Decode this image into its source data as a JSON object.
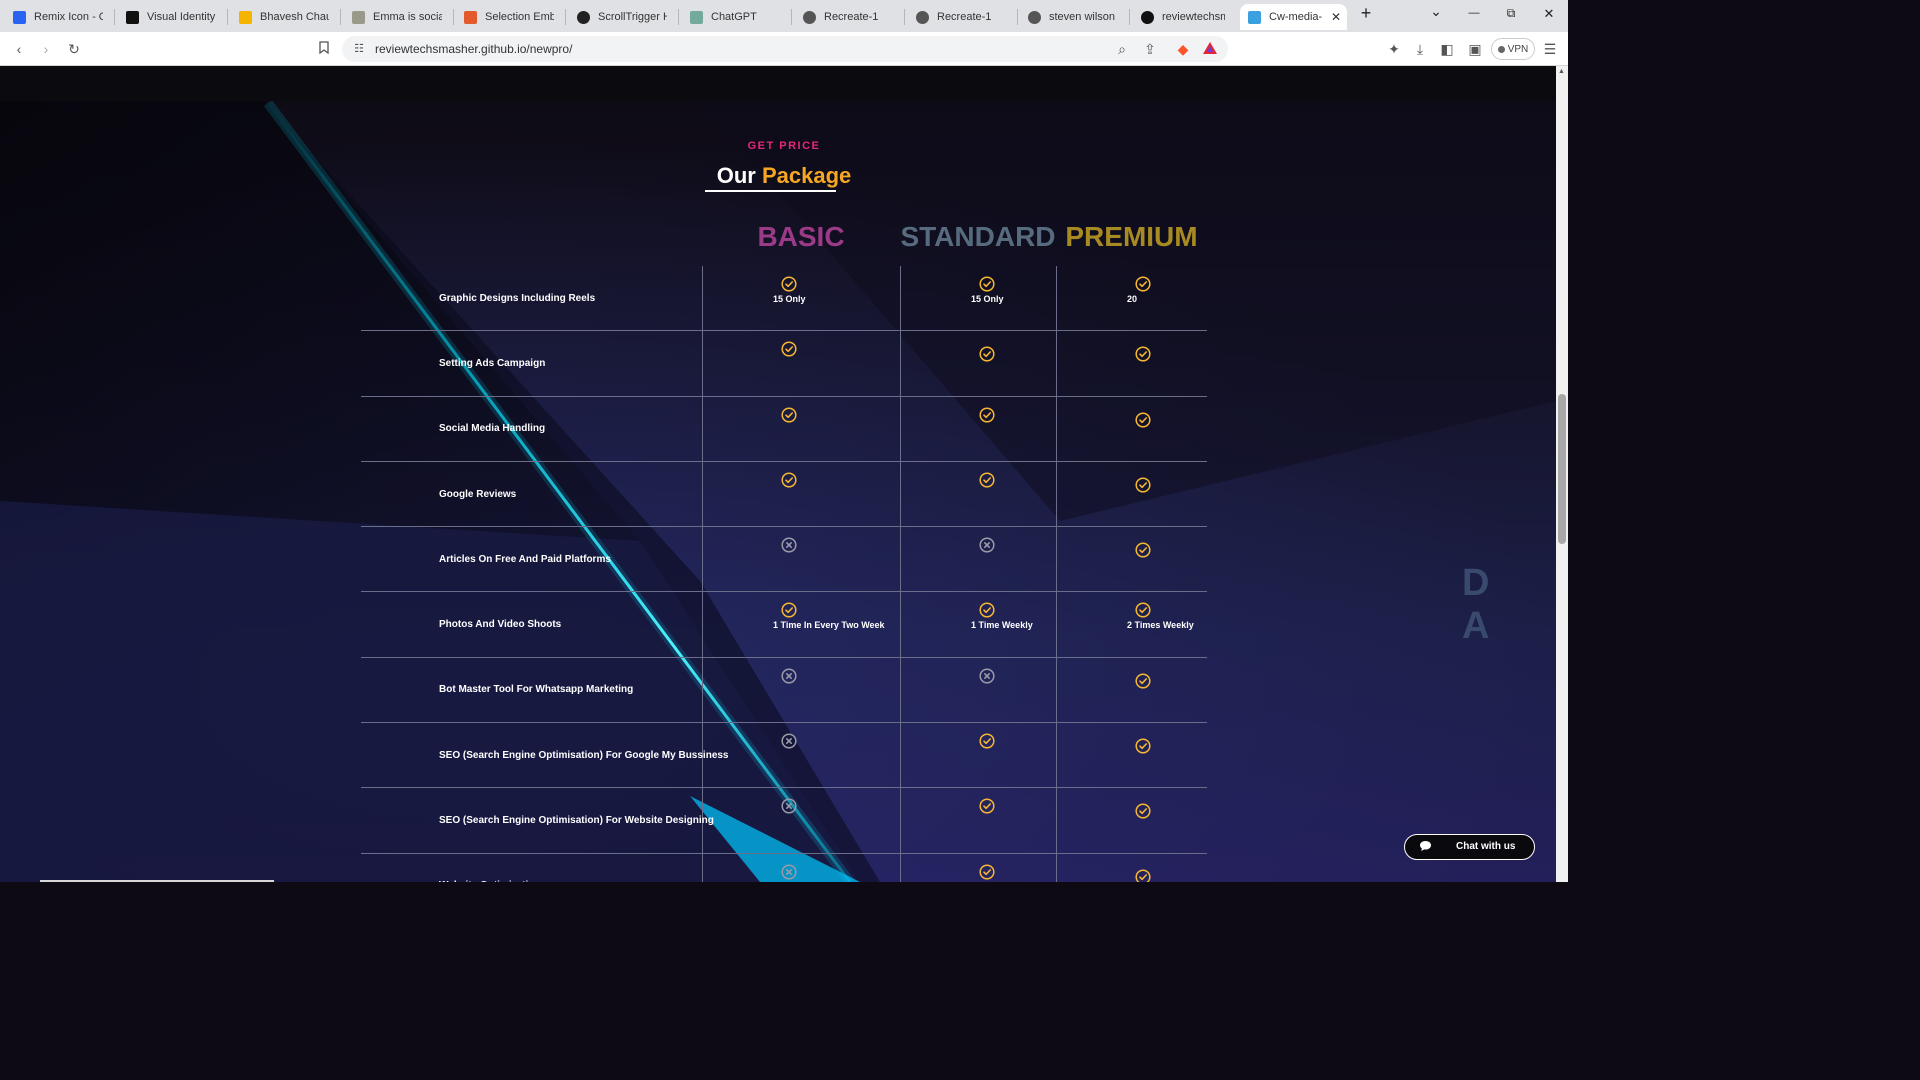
{
  "browser": {
    "tabs": [
      {
        "label": "Remix Icon - Ope",
        "favicon": "remix-icon",
        "color": "#2a63f2"
      },
      {
        "label": "Visual Identity | V",
        "favicon": "visual-identity-icon",
        "color": "#111111"
      },
      {
        "label": "Bhavesh Chaube",
        "favicon": "bookmark-arrow-icon",
        "color": "#f4b400"
      },
      {
        "label": "Emma is social | I",
        "favicon": "image-icon",
        "color": "#9a9a8a"
      },
      {
        "label": "Selection Embed",
        "favicon": "figma-icon",
        "color": "#e35a2b"
      },
      {
        "label": "ScrollTrigger How",
        "favicon": "scrolltrigger-icon",
        "color": "#222222"
      },
      {
        "label": "ChatGPT",
        "favicon": "chatgpt-icon",
        "color": "#74aa9c"
      },
      {
        "label": "Recreate-1",
        "favicon": "globe-icon",
        "color": "#555555"
      },
      {
        "label": "Recreate-1",
        "favicon": "globe-icon",
        "color": "#555555"
      },
      {
        "label": "steven wilson",
        "favicon": "globe-icon",
        "color": "#555555"
      },
      {
        "label": "reviewtechsmash",
        "favicon": "github-icon",
        "color": "#111111"
      },
      {
        "label": "Cw-media- a",
        "favicon": "site-icon",
        "color": "#3aa0e0",
        "active": true
      }
    ],
    "url": "reviewtechsmasher.github.io/newpro/",
    "vpn_label": "VPN"
  },
  "section": {
    "eyebrow": "GET PRICE",
    "heading_white": "Our",
    "heading_orange": "Package",
    "accent_color": "#f5a623",
    "eyebrow_color": "#e8277a"
  },
  "plans": [
    "BASIC",
    "STANDARD",
    "PREMIUM"
  ],
  "rows": [
    {
      "feature": "Graphic Designs Including Reels",
      "basic": {
        "icon": "check-circle",
        "note": "15 Only"
      },
      "standard": {
        "icon": "check-circle",
        "note": "15 Only"
      },
      "premium": {
        "icon": "check-circle",
        "note": "20"
      }
    },
    {
      "feature": "Setting Ads Campaign",
      "basic": {
        "icon": "check-circle",
        "note": ""
      },
      "standard": {
        "icon": "check-circle",
        "note": ""
      },
      "premium": {
        "icon": "check-circle",
        "note": ""
      }
    },
    {
      "feature": "Social Media Handling",
      "basic": {
        "icon": "check-circle",
        "note": ""
      },
      "standard": {
        "icon": "check-circle",
        "note": ""
      },
      "premium": {
        "icon": "check-circle",
        "note": ""
      }
    },
    {
      "feature": "Google Reviews",
      "basic": {
        "icon": "check-circle",
        "note": ""
      },
      "standard": {
        "icon": "check-circle",
        "note": ""
      },
      "premium": {
        "icon": "check-circle",
        "note": ""
      }
    },
    {
      "feature": "Articles On Free And Paid Platforms",
      "basic": {
        "icon": "x-circle",
        "note": ""
      },
      "standard": {
        "icon": "x-circle",
        "note": ""
      },
      "premium": {
        "icon": "check-circle",
        "note": ""
      }
    },
    {
      "feature": "Photos And Video Shoots",
      "basic": {
        "icon": "check-circle",
        "note": "1 Time In Every Two Week"
      },
      "standard": {
        "icon": "check-circle",
        "note": "1 Time Weekly"
      },
      "premium": {
        "icon": "check-circle",
        "note": "2 Times Weekly"
      }
    },
    {
      "feature": "Bot Master Tool For Whatsapp Marketing",
      "basic": {
        "icon": "x-circle",
        "note": ""
      },
      "standard": {
        "icon": "x-circle",
        "note": ""
      },
      "premium": {
        "icon": "check-circle",
        "note": ""
      }
    },
    {
      "feature": "SEO (Search Engine Optimisation) For Google My Bussiness",
      "basic": {
        "icon": "x-circle",
        "note": ""
      },
      "standard": {
        "icon": "check-circle",
        "note": ""
      },
      "premium": {
        "icon": "check-circle",
        "note": ""
      }
    },
    {
      "feature": "SEO (Search Engine Optimisation) For Website Designing",
      "basic": {
        "icon": "x-circle",
        "note": ""
      },
      "standard": {
        "icon": "check-circle",
        "note": ""
      },
      "premium": {
        "icon": "check-circle",
        "note": ""
      }
    },
    {
      "feature": "Website Optimization",
      "basic": {
        "icon": "x-circle",
        "note": ""
      },
      "standard": {
        "icon": "check-circle",
        "note": ""
      },
      "premium": {
        "icon": "check-circle",
        "note": ""
      }
    }
  ],
  "side_text": "D A",
  "chat": {
    "label": "Chat with us",
    "icon": "chat-bubble-icon"
  },
  "colors": {
    "check": "#f5b731",
    "cross": "#9a9aa8"
  }
}
